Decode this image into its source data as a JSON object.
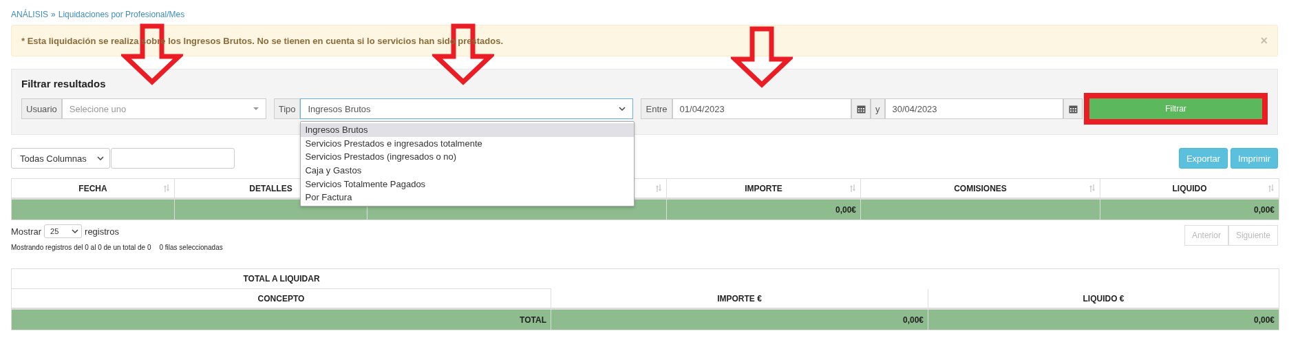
{
  "breadcrumb": {
    "items": [
      {
        "label": "ANÁLISIS"
      },
      {
        "label": "Liquidaciones por Profesional/Mes"
      }
    ],
    "separator": "»"
  },
  "alert": {
    "text": "* Esta liquidación se realiza sobre los Ingresos Brutos. No se tienen en cuenta si lo servicios han sido prestados.",
    "close": "×"
  },
  "filter": {
    "title": "Filtrar resultados",
    "usuario": {
      "label": "Usuario",
      "placeholder": "Selecione uno"
    },
    "tipo": {
      "label": "Tipo",
      "value": "Ingresos Brutos",
      "expanded": true,
      "options": [
        {
          "label": "Ingresos Brutos",
          "selected": true
        },
        {
          "label": "Servicios Prestados e ingresados totalmente",
          "selected": false
        },
        {
          "label": "Servicios Prestados (ingresados o no)",
          "selected": false
        },
        {
          "label": "Caja y Gastos",
          "selected": false
        },
        {
          "label": "Servicios Totalmente Pagados",
          "selected": false
        },
        {
          "label": "Por Factura",
          "selected": false
        }
      ]
    },
    "range": {
      "label": "Entre",
      "from": "01/04/2023",
      "join": "y",
      "to": "30/04/2023"
    },
    "button": "Filtrar"
  },
  "annotations": [
    {
      "kind": "arrow"
    },
    {
      "kind": "arrow"
    },
    {
      "kind": "arrow"
    },
    {
      "kind": "highlight"
    }
  ],
  "table": {
    "column_filter": "Todas Columnas",
    "buttons": [
      "Exportar",
      "Imprimir"
    ],
    "columns": [
      {
        "label": "FECHA",
        "sortable": true
      },
      {
        "label": "DETALLES"
      },
      {
        "sortable": true
      },
      {
        "label": "IMPORTE",
        "total": "0,00€",
        "sortable": true
      },
      {
        "label": "COMISIONES",
        "sortable": true
      },
      {
        "label": "LIQUIDO",
        "total": "0,00€",
        "sortable": true
      }
    ],
    "length": {
      "before": "Mostrar",
      "value": "25",
      "after": "registros"
    },
    "info": "Mostrando registros del 0 al 0 de un total de 0",
    "selected_info": "0 filas seleccionadas",
    "pagination": [
      {
        "label": "Anterior",
        "disabled": true
      },
      {
        "label": "Siguiente",
        "disabled": true
      }
    ]
  },
  "summary": {
    "title": "TOTAL A LIQUIDAR",
    "columns": [
      {
        "label": "CONCEPTO",
        "total": "TOTAL"
      },
      {
        "label": "IMPORTE €",
        "total": "0,00€"
      },
      {
        "label": "LIQUIDO €",
        "total": "0,00€"
      }
    ]
  }
}
